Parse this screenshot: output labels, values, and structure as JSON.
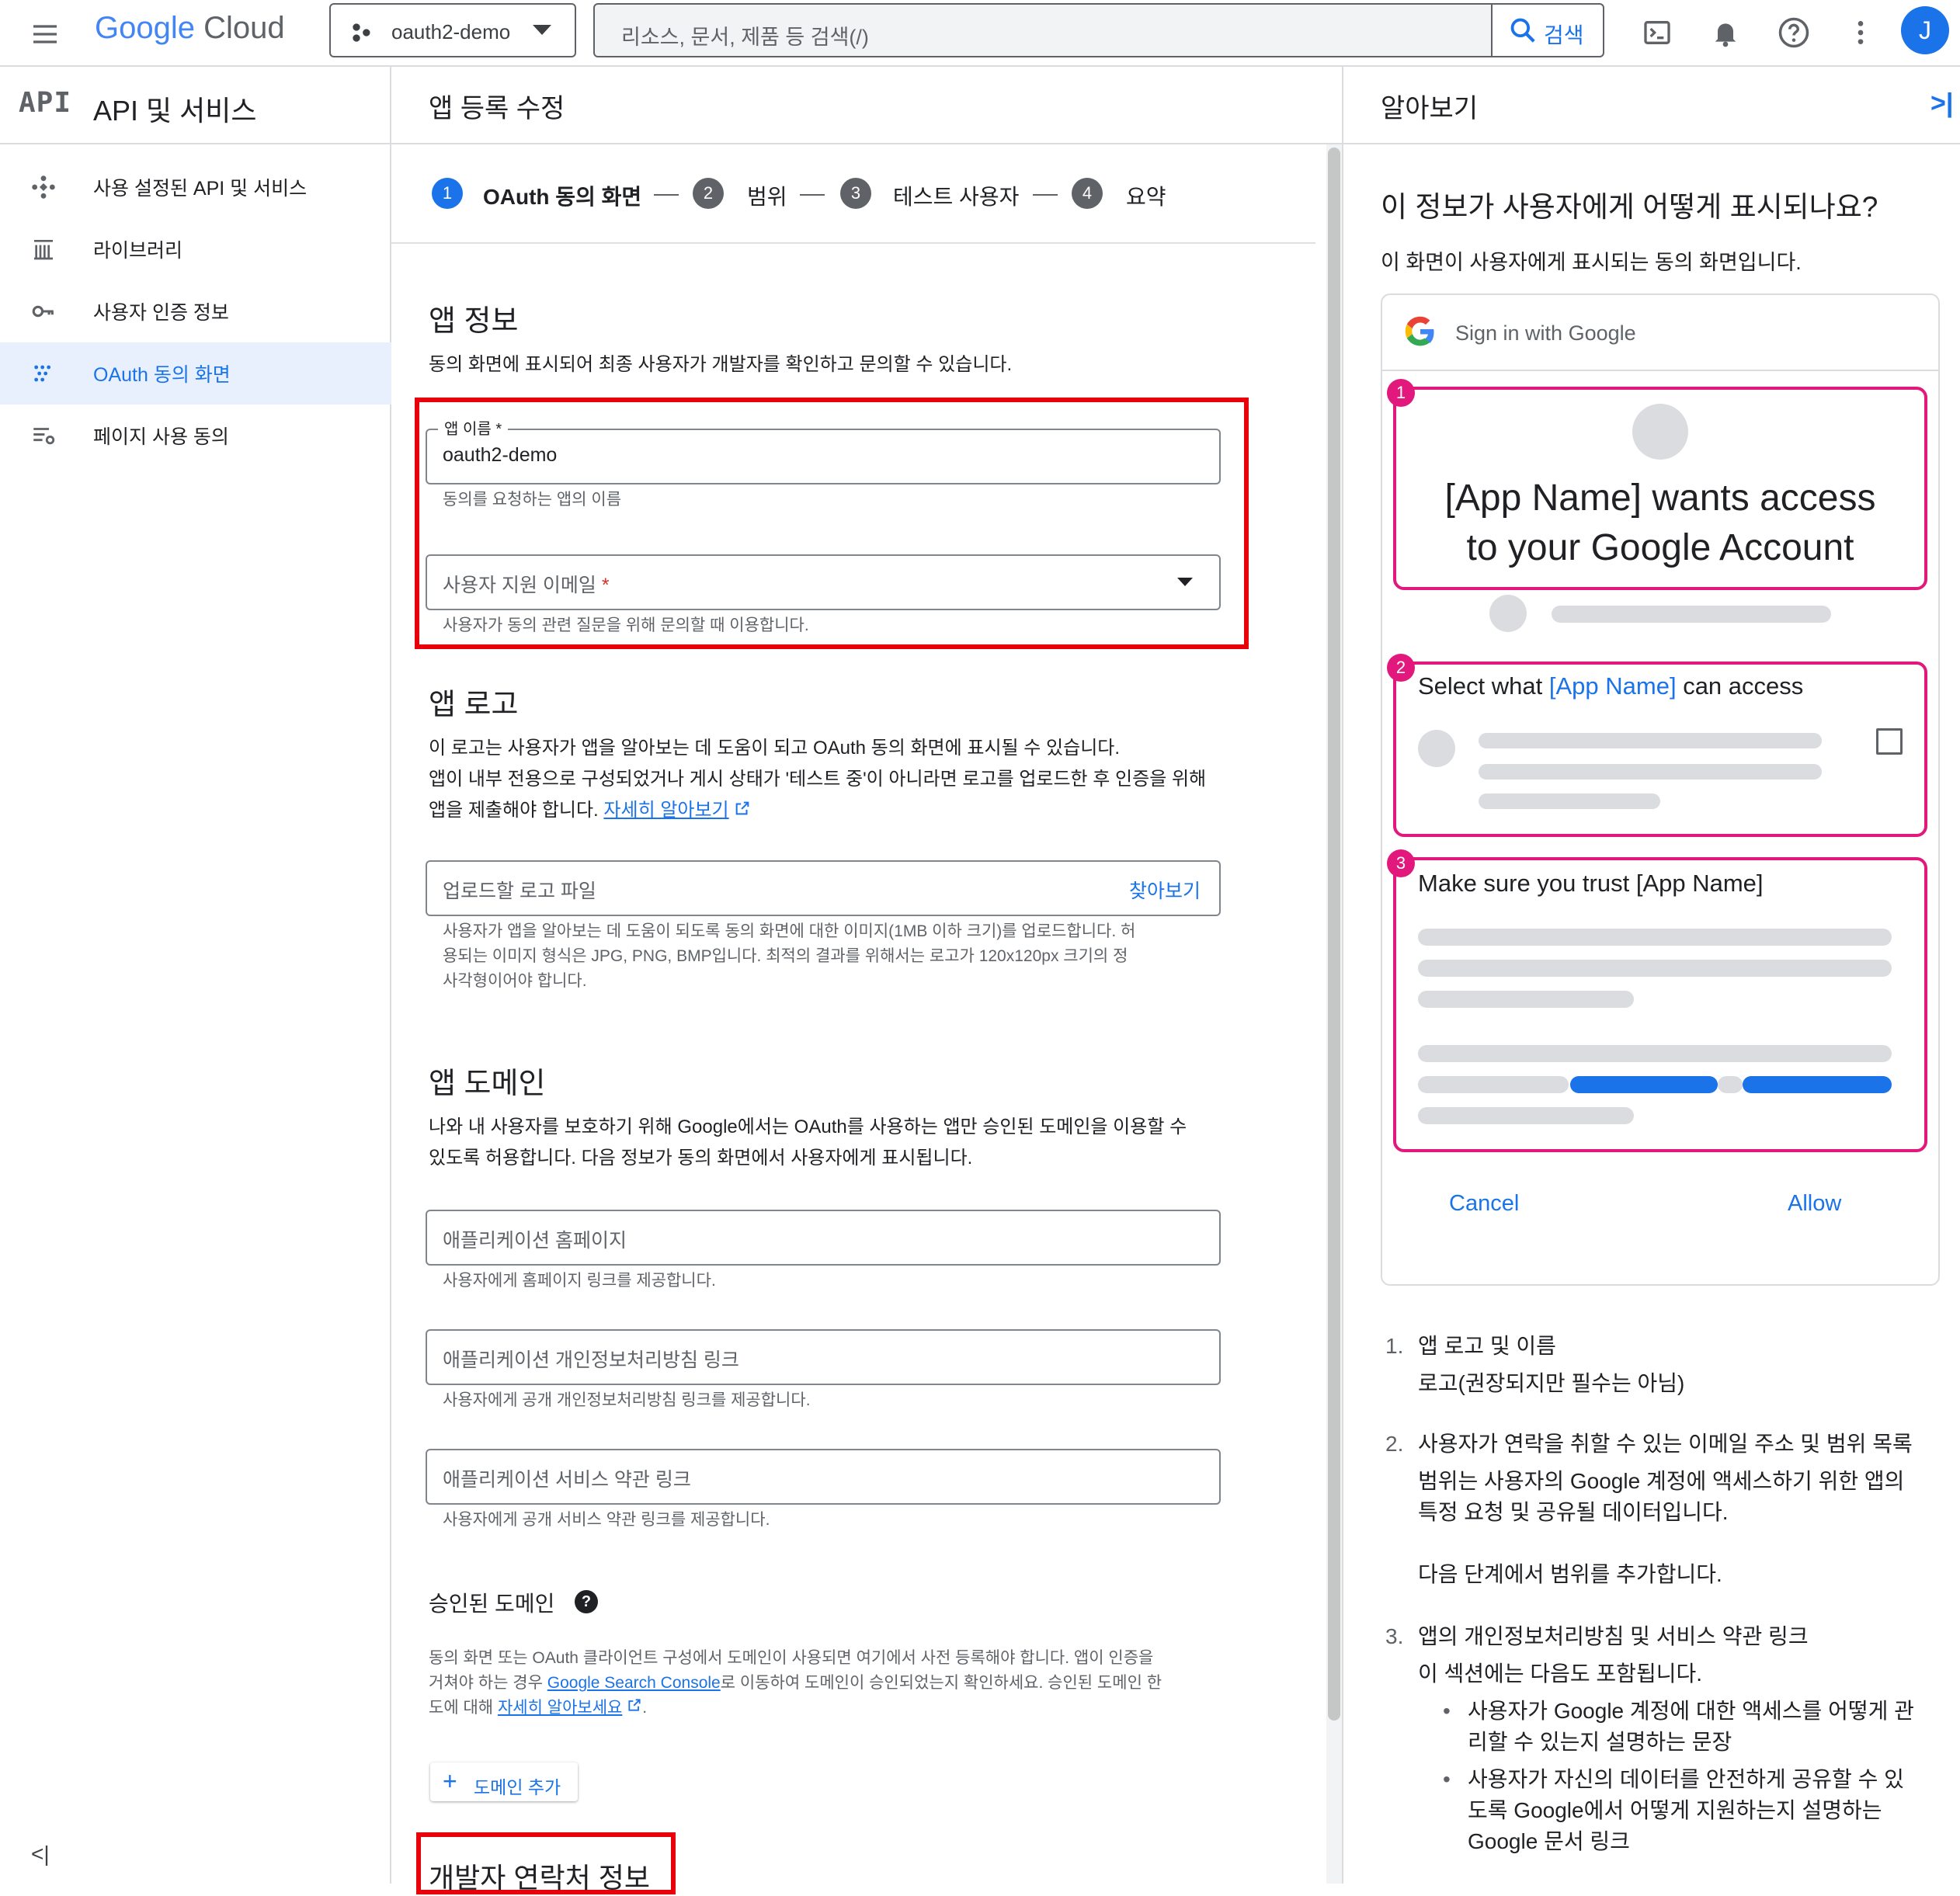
{
  "topbar": {
    "logo_google": "Google",
    "logo_cloud": "Cloud",
    "project": "oauth2-demo",
    "search_placeholder": "리소스, 문서, 제품 등 검색(/)",
    "search_button": "검색",
    "avatar": "J"
  },
  "nav": {
    "header_icon": "API",
    "header_title": "API 및 서비스",
    "items": [
      {
        "label": "사용 설정된 API 및 서비스",
        "icon": "api-diamond-icon"
      },
      {
        "label": "라이브러리",
        "icon": "library-icon"
      },
      {
        "label": "사용자 인증 정보",
        "icon": "key-icon"
      },
      {
        "label": "OAuth 동의 화면",
        "icon": "consent-dots-icon",
        "active": true
      },
      {
        "label": "페이지 사용 동의",
        "icon": "settings-list-icon"
      }
    ]
  },
  "main": {
    "title": "앱 등록 수정",
    "steps": [
      {
        "num": "1",
        "label": "OAuth 동의 화면",
        "active": true
      },
      {
        "num": "2",
        "label": "범위"
      },
      {
        "num": "3",
        "label": "테스트 사용자"
      },
      {
        "num": "4",
        "label": "요약"
      }
    ],
    "appinfo": {
      "heading": "앱 정보",
      "desc": "동의 화면에 표시되어 최종 사용자가 개발자를 확인하고 문의할 수 있습니다.",
      "name_label": "앱 이름 *",
      "name_value": "oauth2-demo",
      "name_help": "동의를 요청하는 앱의 이름",
      "email_label": "사용자 지원 이메일",
      "email_star": "*",
      "email_help": "사용자가 동의 관련 질문을 위해 문의할 때 이용합니다."
    },
    "logo": {
      "heading": "앱 로고",
      "desc1": "이 로고는 사용자가 앱을 알아보는 데 도움이 되고 OAuth 동의 화면에 표시될 수 있습니다.",
      "desc2": "앱이 내부 전용으로 구성되었거나 게시 상태가 '테스트 중'이 아니라면 로고를 업로드한 후 인증을 위해",
      "desc3": "앱을 제출해야 합니다.",
      "learn_more": "자세히 알아보기",
      "upload_placeholder": "업로드할 로고 파일",
      "browse": "찾아보기",
      "help1": "사용자가 앱을 알아보는 데 도움이 되도록 동의 화면에 대한 이미지(1MB 이하 크기)를 업로드합니다. 허",
      "help2": "용되는 이미지 형식은 JPG, PNG, BMP입니다. 최적의 결과를 위해서는 로고가 120x120px 크기의 정",
      "help3": "사각형이어야 합니다."
    },
    "domain": {
      "heading": "앱 도메인",
      "desc1": "나와 내 사용자를 보호하기 위해 Google에서는 OAuth를 사용하는 앱만 승인된 도메인을 이용할 수",
      "desc2": "있도록 허용합니다. 다음 정보가 동의 화면에서 사용자에게 표시됩니다.",
      "homepage_ph": "애플리케이션 홈페이지",
      "homepage_help": "사용자에게 홈페이지 링크를 제공합니다.",
      "privacy_ph": "애플리케이션 개인정보처리방침 링크",
      "privacy_help": "사용자에게 공개 개인정보처리방침 링크를 제공합니다.",
      "tos_ph": "애플리케이션 서비스 약관 링크",
      "tos_help": "사용자에게 공개 서비스 약관 링크를 제공합니다."
    },
    "authorized": {
      "heading": "승인된 도메인",
      "help_icon": "?",
      "desc1": "동의 화면 또는 OAuth 클라이언트 구성에서 도메인이 사용되면 여기에서 사전 등록해야 합니다. 앱이 인증을",
      "desc2a": "거쳐야 하는 경우 ",
      "desc2link": "Google Search Console",
      "desc2b": "로 이동하여 도메인이 승인되었는지 확인하세요. 승인된 도메인 한",
      "desc3a": "도에 대해 ",
      "desc3link": "자세히 알아보세요",
      "desc3b": ".",
      "add_button": "도메인 추가"
    },
    "dev_contact": {
      "heading": "개발자 연락처 정보"
    }
  },
  "side": {
    "title": "알아보기",
    "heading": "이 정보가 사용자에게 어떻게 표시되나요?",
    "desc": "이 화면이 사용자에게 표시되는 동의 화면입니다.",
    "preview": {
      "signin": "Sign in with Google",
      "box1": "[App Name] wants access",
      "box1b": "to your Google Account",
      "box2a": "Select what ",
      "box2name": "[App Name]",
      "box2b": " can access",
      "box3": "Make sure you trust [App Name]",
      "cancel": "Cancel",
      "allow": "Allow",
      "n1": "1",
      "n2": "2",
      "n3": "3"
    },
    "list": [
      {
        "num": "1.",
        "title": "앱 로고 및 이름",
        "body": "로고(권장되지만 필수는 아님)"
      },
      {
        "num": "2.",
        "title": "사용자가 연락을 취할 수 있는 이메일 주소 및 범위 목록",
        "body1": "범위는 사용자의 Google 계정에 액세스하기 위한 앱의",
        "body2": "특정 요청 및 공유될 데이터입니다.",
        "body3": "다음 단계에서 범위를 추가합니다."
      },
      {
        "num": "3.",
        "title": "앱의 개인정보처리방침 및 서비스 약관 링크",
        "body": "이 섹션에는 다음도 포함됩니다.",
        "b1a": "사용자가 Google 계정에 대한 액세스를 어떻게 관",
        "b1b": "리할 수 있는지 설명하는 문장",
        "b2a": "사용자가 자신의 데이터를 안전하게 공유할 수 있",
        "b2b": "도록 Google에서 어떻게 지원하는지 설명하는",
        "b2c": "Google 문서 링크"
      }
    ]
  },
  "colors": {
    "accent": "#1a73e8",
    "highlight_red": "#e8000b",
    "preview_pink": "#e2187c"
  }
}
